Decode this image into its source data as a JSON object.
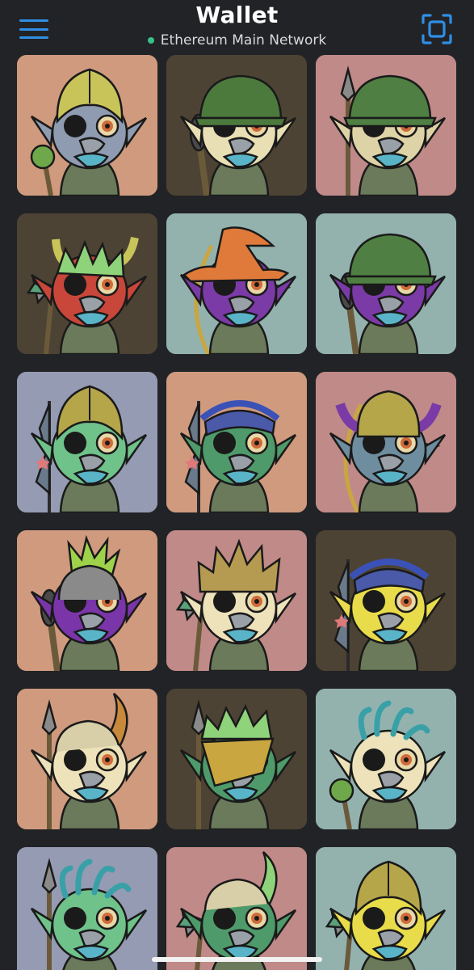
{
  "header": {
    "title": "Wallet",
    "network": "Ethereum Main Network",
    "network_status_color": "#37c18a",
    "accent_color": "#2f8fe6",
    "menu_icon": "hamburger-menu-icon",
    "scan_icon": "qr-scan-icon"
  },
  "nfts": [
    {
      "bg": "#cf9a7e",
      "skin": "#8f9bb0",
      "hat": "#c9c45a",
      "hat_type": "helmet-spiky",
      "item": "mace"
    },
    {
      "bg": "#4d4334",
      "skin": "#e8dfb4",
      "hat": "#4c7a3d",
      "hat_type": "army-helmet",
      "item": "club"
    },
    {
      "bg": "#bf8a88",
      "skin": "#ddd3a6",
      "hat": "#4f7f43",
      "hat_type": "army-helmet",
      "item": "spear"
    },
    {
      "bg": "#4d4334",
      "skin": "#c8473a",
      "hat": "#8ed27a",
      "hat_type": "horns",
      "item": "axe"
    },
    {
      "bg": "#93b2ae",
      "skin": "#7b3ba6",
      "hat": "#e07a3a",
      "hat_type": "witch-hat",
      "item": "bow"
    },
    {
      "bg": "#93b2ae",
      "skin": "#7b3ba6",
      "hat": "#4f7f43",
      "hat_type": "army-helmet",
      "item": "club"
    },
    {
      "bg": "#959bb2",
      "skin": "#6fc28a",
      "hat": "#b5a64a",
      "hat_type": "helmet",
      "item": "flag"
    },
    {
      "bg": "#cf9a7e",
      "skin": "#4f9a6a",
      "hat": "#4a5aa8",
      "hat_type": "headband",
      "item": "flag"
    },
    {
      "bg": "#bf8a88",
      "skin": "#6e8ea0",
      "hat": "#b5a64a",
      "hat_type": "horned-helmet",
      "item": "bow"
    },
    {
      "bg": "#cf9a7e",
      "skin": "#7a35a8",
      "hat": "#9ed24a",
      "hat_type": "mohawk",
      "item": "club"
    },
    {
      "bg": "#bf8a88",
      "skin": "#ede2ba",
      "hat": "#b59a52",
      "hat_type": "spiky-hair",
      "item": "axe"
    },
    {
      "bg": "#4d4334",
      "skin": "#e8dc4a",
      "hat": "#4a5aa8",
      "hat_type": "headband",
      "item": "flag"
    },
    {
      "bg": "#cf9a7e",
      "skin": "#ede2ba",
      "hat": "#c9893a",
      "hat_type": "horn",
      "item": "spear"
    },
    {
      "bg": "#4d4334",
      "skin": "#4f9a6a",
      "hat": "#8ed27a",
      "hat_type": "eyepatch-hair",
      "item": "spear"
    },
    {
      "bg": "#93b2ae",
      "skin": "#ede2ba",
      "hat": "#3aa0a8",
      "hat_type": "tentacle-hair",
      "item": "mace"
    },
    {
      "bg": "#959bb2",
      "skin": "#6fc28a",
      "hat": "#3aa0a8",
      "hat_type": "tentacle-hair",
      "item": "spear"
    },
    {
      "bg": "#bf8a88",
      "skin": "#4f9a6a",
      "hat": "#8ed27a",
      "hat_type": "horn",
      "item": "axe"
    },
    {
      "bg": "#93b2ae",
      "skin": "#e8dc4a",
      "hat": "#b5a64a",
      "hat_type": "helmet",
      "item": "axe"
    }
  ]
}
